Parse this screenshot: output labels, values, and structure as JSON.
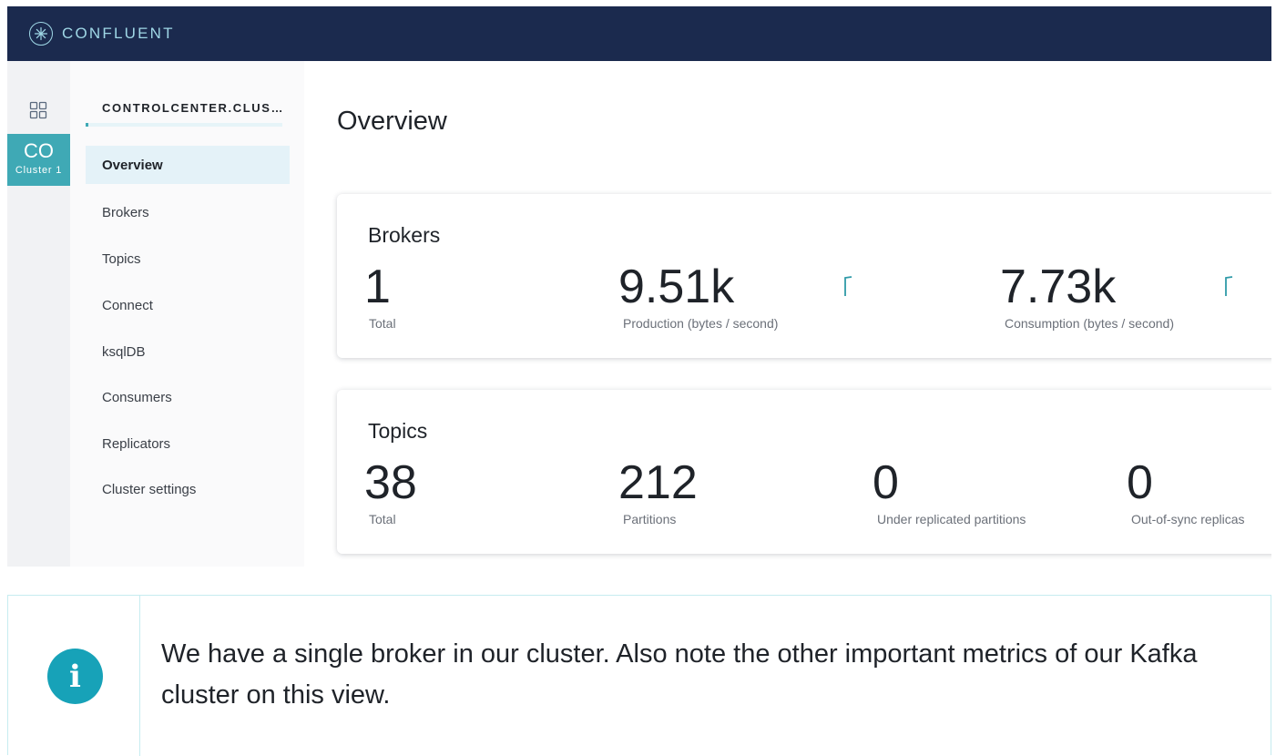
{
  "header": {
    "brand": "CONFLUENT"
  },
  "rail": {
    "cluster_abbr": "CO",
    "cluster_name": "Cluster 1"
  },
  "sidenav": {
    "cluster_title": "CONTROLCENTER.CLUS…",
    "items": [
      {
        "label": "Overview",
        "active": true
      },
      {
        "label": "Brokers"
      },
      {
        "label": "Topics"
      },
      {
        "label": "Connect"
      },
      {
        "label": "ksqlDB"
      },
      {
        "label": "Consumers"
      },
      {
        "label": "Replicators"
      },
      {
        "label": "Cluster settings"
      }
    ]
  },
  "main": {
    "page_title": "Overview",
    "brokers_card": {
      "title": "Brokers",
      "metrics": [
        {
          "value": "1",
          "label": "Total"
        },
        {
          "value": "9.51k",
          "label": "Production (bytes / second)"
        },
        {
          "value": "7.73k",
          "label": "Consumption (bytes / second)"
        }
      ]
    },
    "topics_card": {
      "title": "Topics",
      "metrics": [
        {
          "value": "38",
          "label": "Total"
        },
        {
          "value": "212",
          "label": "Partitions"
        },
        {
          "value": "0",
          "label": "Under replicated partitions"
        },
        {
          "value": "0",
          "label": "Out-of-sync replicas"
        }
      ]
    }
  },
  "callout": {
    "icon": "info-icon",
    "text": "We have a single broker in our cluster. Also note the other important metrics of our Kafka cluster on this view."
  },
  "colors": {
    "topbar": "#1b2a4e",
    "accent": "#3fa9b5",
    "info": "#17a2b8"
  }
}
